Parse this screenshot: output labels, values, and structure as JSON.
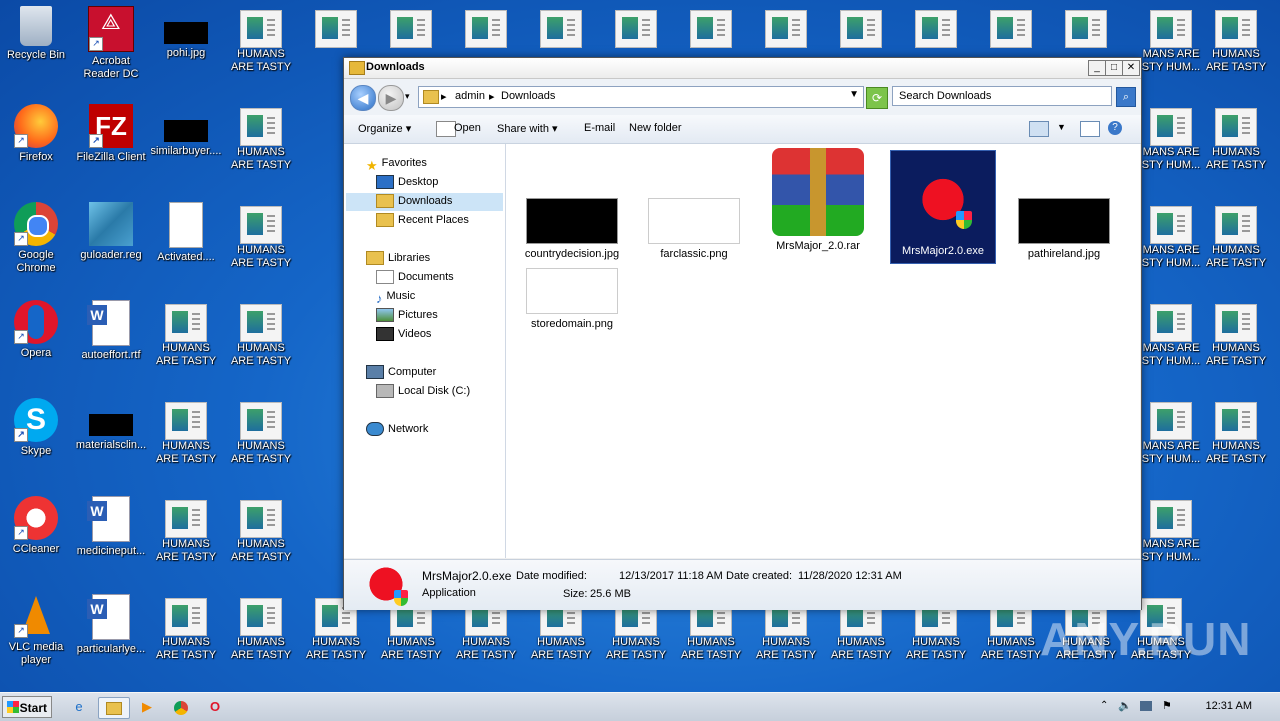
{
  "desktop": {
    "icons_col1": [
      {
        "label": "Recycle Bin",
        "icon": "recycle-bin-icon"
      },
      {
        "label": "Firefox",
        "icon": "firefox-icon"
      },
      {
        "label": "Google Chrome",
        "icon": "chrome-icon"
      },
      {
        "label": "Opera",
        "icon": "opera-icon"
      },
      {
        "label": "Skype",
        "icon": "skype-icon"
      },
      {
        "label": "CCleaner",
        "icon": "ccleaner-icon"
      },
      {
        "label": "VLC media player",
        "icon": "vlc-icon"
      }
    ],
    "icons_col2": [
      {
        "label": "Acrobat Reader DC",
        "icon": "acrobat-icon"
      },
      {
        "label": "FileZilla Client",
        "icon": "filezilla-icon"
      },
      {
        "label": "guloader.reg",
        "icon": "registry-file-icon"
      },
      {
        "label": "autoeffort.rtf",
        "icon": "word-doc-icon"
      },
      {
        "label": "materialsclin...",
        "icon": "image-file-icon"
      },
      {
        "label": "medicineput...",
        "icon": "word-doc-icon"
      },
      {
        "label": "particularlye...",
        "icon": "word-doc-icon"
      }
    ],
    "icons_col3": [
      {
        "label": "pohi.jpg",
        "icon": "image-file-icon"
      },
      {
        "label": "similarbuyer....",
        "icon": "image-file-icon"
      },
      {
        "label": "Activated....",
        "icon": "blank-file-icon"
      },
      {
        "label": "HUMANS ARE TASTY HU...",
        "icon": "html-file-icon"
      },
      {
        "label": "HUMANS ARE TASTY HU...",
        "icon": "html-file-icon"
      },
      {
        "label": "HUMANS ARE TASTY HU...",
        "icon": "html-file-icon"
      },
      {
        "label": "HUMANS ARE TASTY HU...",
        "icon": "html-file-icon"
      }
    ],
    "repeated_label": "HUMANS ARE TASTY HU...",
    "repeated_label_alt": "HUMANS ARE TASTY HUM...",
    "right_partial_label": "MANS ARE STY HUM..."
  },
  "window": {
    "title": "Downloads",
    "address": {
      "crumbs": [
        "admin",
        "Downloads"
      ]
    },
    "search_placeholder": "Search Downloads",
    "toolbar": {
      "organize": "Organize",
      "open": "Open",
      "share_with": "Share with",
      "email": "E-mail",
      "new_folder": "New folder"
    },
    "nav": {
      "favorites": "Favorites",
      "desktop": "Desktop",
      "downloads": "Downloads",
      "recent_places": "Recent Places",
      "libraries": "Libraries",
      "documents": "Documents",
      "music": "Music",
      "pictures": "Pictures",
      "videos": "Videos",
      "computer": "Computer",
      "local_disk": "Local Disk (C:)",
      "network": "Network"
    },
    "files": [
      {
        "name": "countrydecision.jpg"
      },
      {
        "name": "farclassic.png"
      },
      {
        "name": "MrsMajor_2.0.rar"
      },
      {
        "name": "MrsMajor2.0.exe",
        "selected": true
      },
      {
        "name": "pathireland.jpg"
      },
      {
        "name": "storedomain.png"
      }
    ],
    "details": {
      "name": "MrsMajor2.0.exe",
      "type": "Application",
      "modified_label": "Date modified:",
      "modified": "12/13/2017 11:18 AM",
      "size_label": "Size:",
      "size": "25.6 MB",
      "created_label": "Date created:",
      "created": "11/28/2020 12:31 AM"
    }
  },
  "taskbar": {
    "start": "Start",
    "clock": "12:31 AM"
  },
  "watermark": "ANY.RUN"
}
